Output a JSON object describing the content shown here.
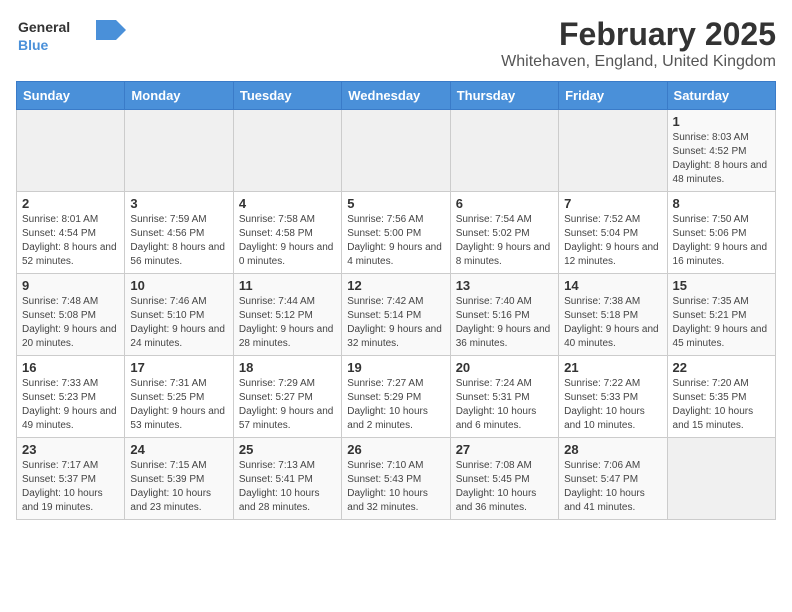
{
  "header": {
    "logo_general": "General",
    "logo_blue": "Blue",
    "month_year": "February 2025",
    "location": "Whitehaven, England, United Kingdom"
  },
  "weekdays": [
    "Sunday",
    "Monday",
    "Tuesday",
    "Wednesday",
    "Thursday",
    "Friday",
    "Saturday"
  ],
  "weeks": [
    [
      {
        "day": "",
        "info": ""
      },
      {
        "day": "",
        "info": ""
      },
      {
        "day": "",
        "info": ""
      },
      {
        "day": "",
        "info": ""
      },
      {
        "day": "",
        "info": ""
      },
      {
        "day": "",
        "info": ""
      },
      {
        "day": "1",
        "info": "Sunrise: 8:03 AM\nSunset: 4:52 PM\nDaylight: 8 hours and 48 minutes."
      }
    ],
    [
      {
        "day": "2",
        "info": "Sunrise: 8:01 AM\nSunset: 4:54 PM\nDaylight: 8 hours and 52 minutes."
      },
      {
        "day": "3",
        "info": "Sunrise: 7:59 AM\nSunset: 4:56 PM\nDaylight: 8 hours and 56 minutes."
      },
      {
        "day": "4",
        "info": "Sunrise: 7:58 AM\nSunset: 4:58 PM\nDaylight: 9 hours and 0 minutes."
      },
      {
        "day": "5",
        "info": "Sunrise: 7:56 AM\nSunset: 5:00 PM\nDaylight: 9 hours and 4 minutes."
      },
      {
        "day": "6",
        "info": "Sunrise: 7:54 AM\nSunset: 5:02 PM\nDaylight: 9 hours and 8 minutes."
      },
      {
        "day": "7",
        "info": "Sunrise: 7:52 AM\nSunset: 5:04 PM\nDaylight: 9 hours and 12 minutes."
      },
      {
        "day": "8",
        "info": "Sunrise: 7:50 AM\nSunset: 5:06 PM\nDaylight: 9 hours and 16 minutes."
      }
    ],
    [
      {
        "day": "9",
        "info": "Sunrise: 7:48 AM\nSunset: 5:08 PM\nDaylight: 9 hours and 20 minutes."
      },
      {
        "day": "10",
        "info": "Sunrise: 7:46 AM\nSunset: 5:10 PM\nDaylight: 9 hours and 24 minutes."
      },
      {
        "day": "11",
        "info": "Sunrise: 7:44 AM\nSunset: 5:12 PM\nDaylight: 9 hours and 28 minutes."
      },
      {
        "day": "12",
        "info": "Sunrise: 7:42 AM\nSunset: 5:14 PM\nDaylight: 9 hours and 32 minutes."
      },
      {
        "day": "13",
        "info": "Sunrise: 7:40 AM\nSunset: 5:16 PM\nDaylight: 9 hours and 36 minutes."
      },
      {
        "day": "14",
        "info": "Sunrise: 7:38 AM\nSunset: 5:18 PM\nDaylight: 9 hours and 40 minutes."
      },
      {
        "day": "15",
        "info": "Sunrise: 7:35 AM\nSunset: 5:21 PM\nDaylight: 9 hours and 45 minutes."
      }
    ],
    [
      {
        "day": "16",
        "info": "Sunrise: 7:33 AM\nSunset: 5:23 PM\nDaylight: 9 hours and 49 minutes."
      },
      {
        "day": "17",
        "info": "Sunrise: 7:31 AM\nSunset: 5:25 PM\nDaylight: 9 hours and 53 minutes."
      },
      {
        "day": "18",
        "info": "Sunrise: 7:29 AM\nSunset: 5:27 PM\nDaylight: 9 hours and 57 minutes."
      },
      {
        "day": "19",
        "info": "Sunrise: 7:27 AM\nSunset: 5:29 PM\nDaylight: 10 hours and 2 minutes."
      },
      {
        "day": "20",
        "info": "Sunrise: 7:24 AM\nSunset: 5:31 PM\nDaylight: 10 hours and 6 minutes."
      },
      {
        "day": "21",
        "info": "Sunrise: 7:22 AM\nSunset: 5:33 PM\nDaylight: 10 hours and 10 minutes."
      },
      {
        "day": "22",
        "info": "Sunrise: 7:20 AM\nSunset: 5:35 PM\nDaylight: 10 hours and 15 minutes."
      }
    ],
    [
      {
        "day": "23",
        "info": "Sunrise: 7:17 AM\nSunset: 5:37 PM\nDaylight: 10 hours and 19 minutes."
      },
      {
        "day": "24",
        "info": "Sunrise: 7:15 AM\nSunset: 5:39 PM\nDaylight: 10 hours and 23 minutes."
      },
      {
        "day": "25",
        "info": "Sunrise: 7:13 AM\nSunset: 5:41 PM\nDaylight: 10 hours and 28 minutes."
      },
      {
        "day": "26",
        "info": "Sunrise: 7:10 AM\nSunset: 5:43 PM\nDaylight: 10 hours and 32 minutes."
      },
      {
        "day": "27",
        "info": "Sunrise: 7:08 AM\nSunset: 5:45 PM\nDaylight: 10 hours and 36 minutes."
      },
      {
        "day": "28",
        "info": "Sunrise: 7:06 AM\nSunset: 5:47 PM\nDaylight: 10 hours and 41 minutes."
      },
      {
        "day": "",
        "info": ""
      }
    ]
  ]
}
